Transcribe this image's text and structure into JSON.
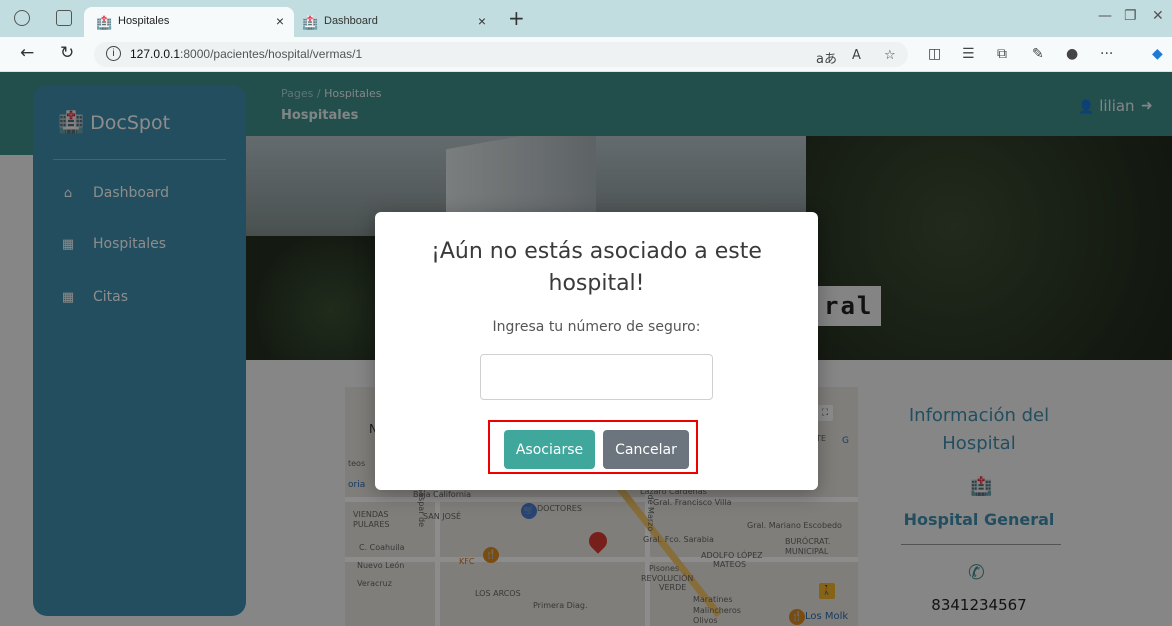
{
  "browser": {
    "tabs": [
      {
        "title": "Hospitales",
        "active": true
      },
      {
        "title": "Dashboard",
        "active": false
      }
    ],
    "url_host": "127.0.0.1",
    "url_path": ":8000/pacientes/hospital/vermas/1"
  },
  "header": {
    "breadcrumb_root": "Pages",
    "breadcrumb_separator": "/",
    "breadcrumb_current": "Hospitales",
    "page_title": "Hospitales",
    "user_name": "lilian"
  },
  "sidebar": {
    "brand": "DocSpot",
    "items": [
      {
        "label": "Dashboard",
        "icon": "home-icon"
      },
      {
        "label": "Hospitales",
        "icon": "hospital-icon"
      },
      {
        "label": "Citas",
        "icon": "hospital-icon"
      }
    ]
  },
  "banner": {
    "title_fragment": "ral"
  },
  "map": {
    "labels": [
      "teos",
      "oria",
      "Baja California",
      "VIENDAS",
      "PULARES",
      "SAN JOSÉ",
      "DOCTORES",
      "Lázaro Cárdenas",
      "Gral. Francisco Villa",
      "Gral. Mariano Escobedo",
      "C. Coahuila",
      "Nuevo León",
      "Veracruz",
      "KFC",
      "Gral. Fco. Sarabia",
      "ADOLFO LÓPEZ",
      "MATEOS",
      "Pisones",
      "REVOLUCIÓN",
      "VERDE",
      "LOS ARCOS",
      "Primera Diag.",
      "Maratines",
      "Malincheros",
      "Olivos",
      "BURÓCRAT.",
      "MUNICIPAL",
      "Los Molk",
      "ENTE",
      "G",
      "N",
      "21 de Marzo",
      "Gaspar de"
    ]
  },
  "info": {
    "title": "Información del Hospital",
    "hospital_name": "Hospital General",
    "phone": "8341234567"
  },
  "modal": {
    "title": "¡Aún no estás asociado a este hospital!",
    "label": "Ingresa tu número de seguro:",
    "input_value": "",
    "confirm_label": "Asociarse",
    "cancel_label": "Cancelar"
  }
}
